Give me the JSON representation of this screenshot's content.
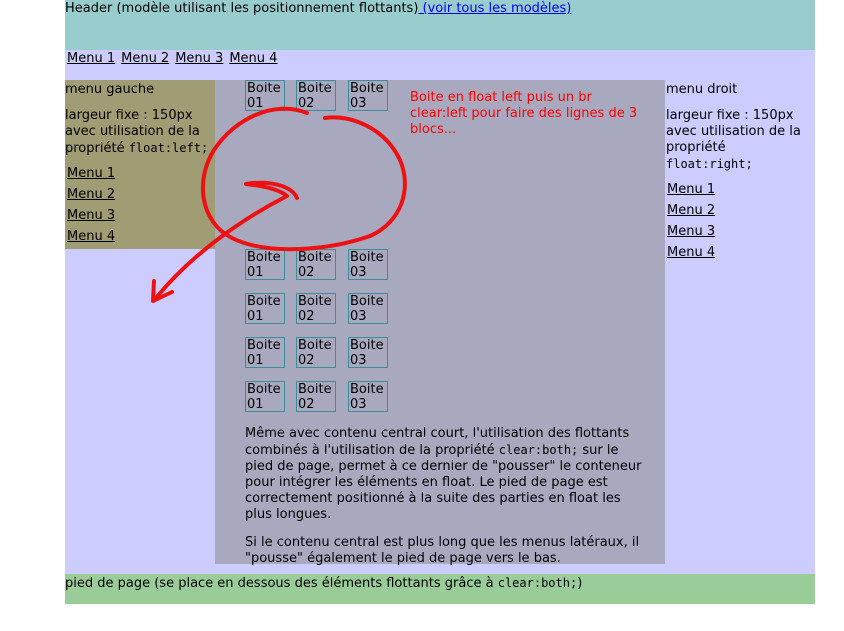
{
  "header": {
    "text": "Header (modèle utilisant les positionnement flottants)",
    "link": " (voir tous les modèles)"
  },
  "topmenu": [
    "Menu 1",
    "Menu 2",
    "Menu 3",
    "Menu 4"
  ],
  "left": {
    "title": "menu gauche",
    "desc_1": "largeur fixe : 150px",
    "desc_2": "avec utilisation de la",
    "desc_3": "propriété ",
    "desc_code": "float:left;",
    "menu": [
      "Menu 1",
      "Menu 2",
      "Menu 3",
      "Menu 4"
    ]
  },
  "right": {
    "title": "menu droit",
    "desc_1": "largeur fixe : 150px",
    "desc_2": "avec utilisation de la",
    "desc_3": "propriété",
    "desc_code": "float:right;",
    "menu": [
      "Menu 1",
      "Menu 2",
      "Menu 3",
      "Menu 4"
    ]
  },
  "center": {
    "boxes": [
      "Boite 01",
      "Boite 02",
      "Boite 03"
    ],
    "box_word": "Boite",
    "box_nums": [
      "01",
      "02",
      "03"
    ],
    "note": "Boite en float left puis un br clear:left pour faire des lignes de 3 blocs...",
    "para1_a": "Même avec contenu central court, l'utilisation des flottants combinés à l'utilisation de la propriété ",
    "para1_code": "clear:both;",
    "para1_b": " sur le pied de page, permet à ce dernier de \"pousser\" le conteneur pour intégrer les éléments en float. Le pied de page est correctement positionné à la suite des parties en float les plus longues.",
    "para2": "Si le contenu central est plus long que les menus latéraux, il \"pousse\" également le pied de page vers le bas."
  },
  "footer": {
    "text": "pied de page (se place en dessous des éléments flottants grâce à ",
    "code": "clear:both;",
    "end": ")"
  },
  "colors": {
    "header": "#99cccc",
    "page": "#ccccff",
    "left_menu": "#a09c74",
    "center": "#a8a8bf",
    "footer": "#99cc99",
    "annotation": "#ee1111"
  }
}
